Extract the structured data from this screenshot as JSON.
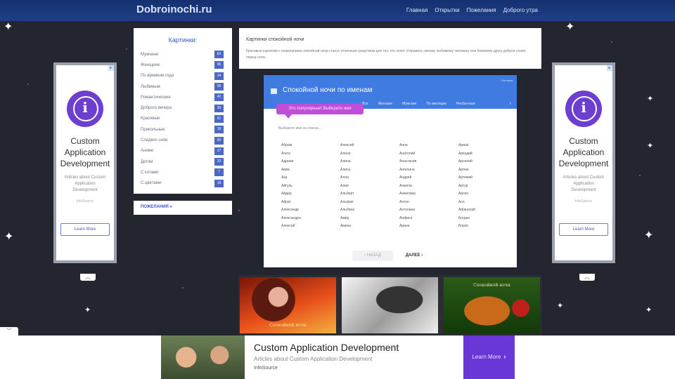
{
  "site": {
    "logo": "Dobroinochi.ru",
    "nav": [
      "Главная",
      "Открытки",
      "Пожелания",
      "Доброго утра"
    ]
  },
  "side_ad": {
    "title": "Custom Application Development",
    "subtitle": "Articles about Custom Application Development",
    "source": "InfoSource",
    "button": "Learn More",
    "info_letter": "i"
  },
  "categories": {
    "header": "Картинки:",
    "items": [
      {
        "label": "Мужчине",
        "count": "82"
      },
      {
        "label": "Женщине",
        "count": "96"
      },
      {
        "label": "По времени года",
        "count": "14"
      },
      {
        "label": "Любимым",
        "count": "55"
      },
      {
        "label": "Романтические",
        "count": "42"
      },
      {
        "label": "Доброго вечера",
        "count": "30"
      },
      {
        "label": "Красивые",
        "count": "61"
      },
      {
        "label": "Прикольные",
        "count": "18"
      },
      {
        "label": "Сладких снов",
        "count": "50"
      },
      {
        "label": "Аниме",
        "count": "27"
      },
      {
        "label": "Детям",
        "count": "23"
      },
      {
        "label": "С котами",
        "count": "7"
      },
      {
        "label": "С цветами",
        "count": "19"
      }
    ],
    "more": "ПОЖЕЛАНИЯ »"
  },
  "intro": {
    "heading": "Картинки спокойной ночи",
    "text": "Красивые картинки с пожеланием спокойной ночи станут отличным средством для тех, кто хочет отправить своему любимому человеку или близкому другу доброе слово перед сном."
  },
  "card": {
    "note": "Реклама",
    "title": "Спокойной ночи по именам",
    "tabs": [
      "Все",
      "Женские",
      "Мужские",
      "По месяцам",
      "Необычные"
    ],
    "pill": "Это популярные! Выберите имя",
    "subtext": "Выберите имя из списка...",
    "names": [
      "Абрам",
      "Алексей",
      "Анна",
      "Арина",
      "Агата",
      "Алена",
      "Анатолий",
      "Аркадий",
      "Адриан",
      "Алина",
      "Анастасия",
      "Арсений",
      "Аким",
      "Алиса",
      "Ангелина",
      "Артем",
      "Аза",
      "Алла",
      "Андрей",
      "Артемий",
      "Айгуль",
      "Алия",
      "Анжела",
      "Артур",
      "Айдар",
      "Альберт",
      "Анжелика",
      "Арсен",
      "Айрат",
      "Альфия",
      "Антон",
      "Ася",
      "Александр",
      "Альбина",
      "Антонина",
      "Афанасий",
      "Александра",
      "Амир",
      "Анфиса",
      "Богдан",
      "Алексей",
      "Амина",
      "Арина",
      "Борис"
    ],
    "prev": "‹ НАЗАД",
    "next": "ДАЛЕЕ ›"
  },
  "thumbs": {
    "caption1": "Спокойной ночи",
    "caption3": "Спокойной ночи"
  },
  "bottom_ad": {
    "title": "Custom Application Development",
    "subtitle": "Articles about Custom Application Development",
    "source": "InfoSource",
    "button": "Learn More"
  },
  "icons": {
    "collapse": "chevron-up-icon",
    "close": "chevron-down-icon"
  }
}
